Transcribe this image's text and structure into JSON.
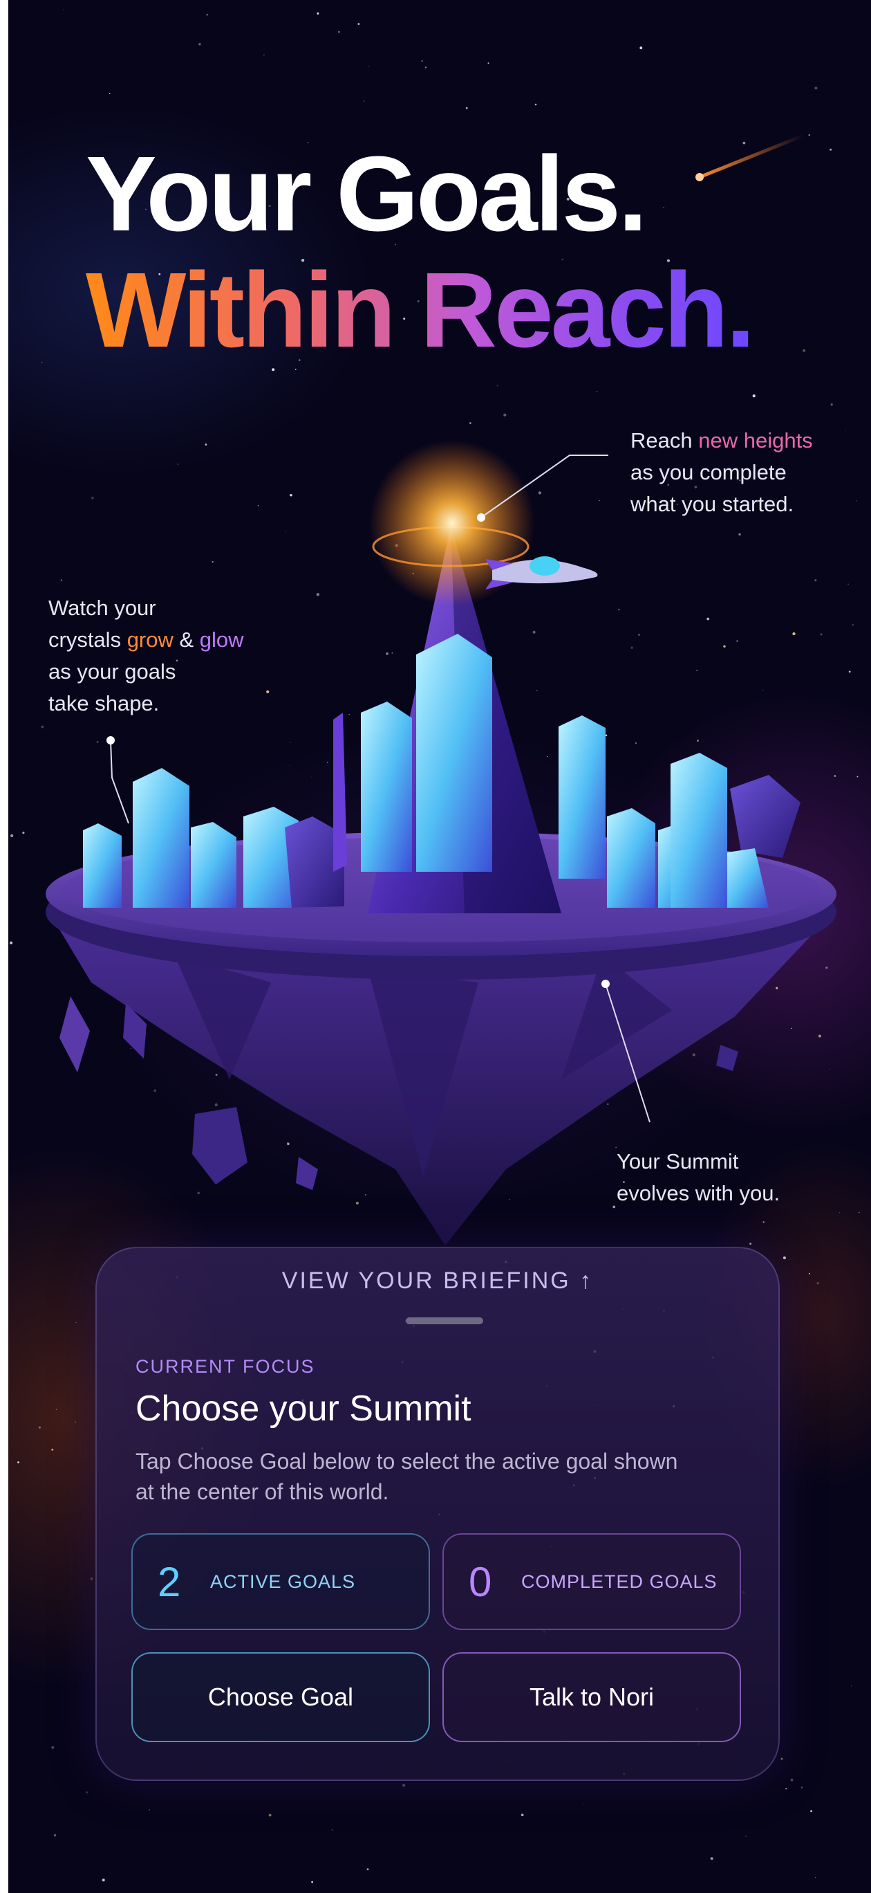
{
  "hero": {
    "title_line1": "Your Goals.",
    "title_line2": "Within Reach."
  },
  "callouts": {
    "heights": {
      "prefix": "Reach ",
      "highlight": "new heights",
      "line2": "as you complete",
      "line3": "what you started."
    },
    "crystals": {
      "line1": "Watch your",
      "prefix": "crystals ",
      "grow": "grow",
      "amp": " & ",
      "glow": "glow",
      "line3": "as your goals",
      "line4": "take shape."
    },
    "summit": {
      "line1": "Your Summit",
      "line2": "evolves with you."
    }
  },
  "briefing": {
    "view_label": "VIEW YOUR BRIEFING ↑",
    "focus_label": "CURRENT FOCUS",
    "focus_title": "Choose your Summit",
    "focus_description": "Tap Choose Goal below to select the active goal shown at the center of this world.",
    "stats": {
      "active": {
        "value": "2",
        "label": "ACTIVE GOALS"
      },
      "completed": {
        "value": "0",
        "label": "COMPLETED GOALS"
      }
    },
    "buttons": {
      "choose_goal": "Choose Goal",
      "talk_to_nori": "Talk to Nori"
    }
  },
  "colors": {
    "background": "#07051a",
    "accent_orange": "#ff8a18",
    "accent_violet": "#8a4cf0",
    "accent_cyan": "#5ed0ff"
  }
}
